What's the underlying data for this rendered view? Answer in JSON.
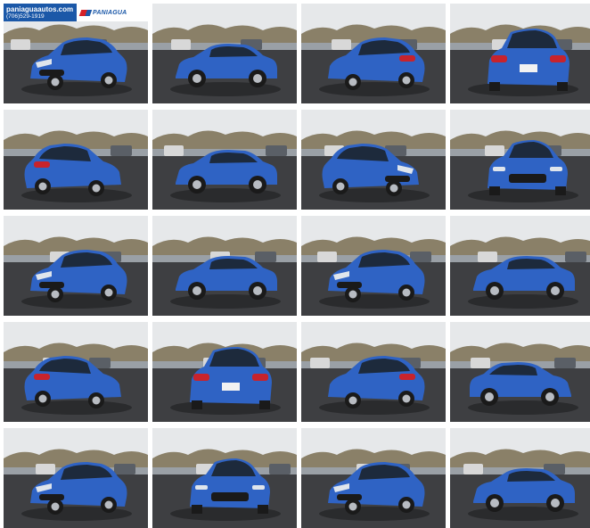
{
  "dealer": {
    "website": "paniaguaautos.com",
    "phone": "(706)529-1919",
    "brand": "PANIAGUA"
  },
  "colors": {
    "car_body": "#2f63c4",
    "car_shadow": "#1c3f8a",
    "asphalt": "#3e3f42",
    "sky": "#e6e8ea",
    "trees": "#8a8068",
    "banner_blue": "#1b58a8",
    "banner_red": "#d62027"
  },
  "photos": [
    {
      "view": "front-three-quarter-left"
    },
    {
      "view": "side-left"
    },
    {
      "view": "rear-three-quarter-right"
    },
    {
      "view": "rear"
    },
    {
      "view": "rear-three-quarter-left"
    },
    {
      "view": "side-left"
    },
    {
      "view": "front-three-quarter-right"
    },
    {
      "view": "front"
    },
    {
      "view": "front-three-quarter-left"
    },
    {
      "view": "side-left"
    },
    {
      "view": "front-three-quarter-left"
    },
    {
      "view": "side-left"
    },
    {
      "view": "rear-three-quarter-left"
    },
    {
      "view": "rear"
    },
    {
      "view": "rear-three-quarter-right"
    },
    {
      "view": "side-right"
    },
    {
      "view": "front-three-quarter-left"
    },
    {
      "view": "front"
    },
    {
      "view": "front-three-quarter-left"
    },
    {
      "view": "side-left"
    }
  ]
}
